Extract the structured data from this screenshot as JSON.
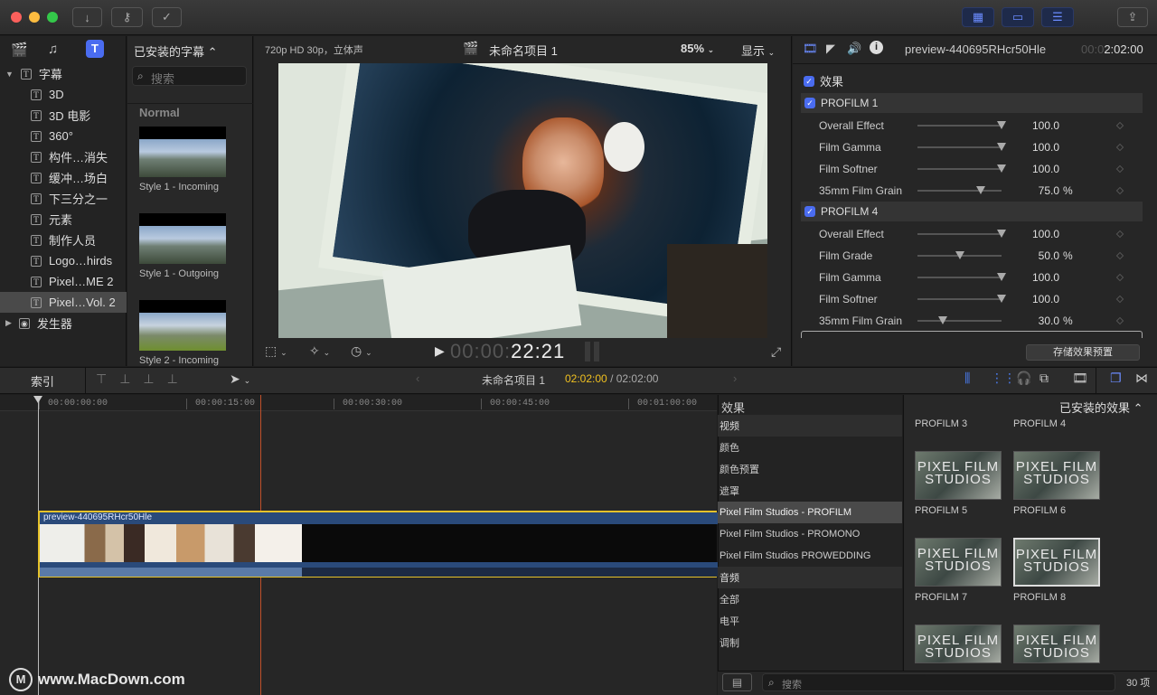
{
  "viewer": {
    "format": "720p HD 30p，立体声",
    "project_title": "未命名项目 1",
    "zoom": "85%",
    "display": "显示",
    "timecode_dim": "00:00:",
    "timecode": "22:21"
  },
  "browser": {
    "header": "已安装的字幕 ⌃",
    "search_placeholder": "搜索",
    "section": "Normal",
    "thumbs": [
      {
        "caption": "Style 1 - Incoming"
      },
      {
        "caption": "Style 1 - Outgoing"
      },
      {
        "caption": "Style 2 - Incoming"
      }
    ]
  },
  "sidebar": {
    "root": "字幕",
    "items": [
      "3D",
      "3D 电影",
      "360°",
      "构件…消失",
      "缓冲…场白",
      "下三分之一",
      "元素",
      "制作人员",
      "Logo…hirds",
      "Pixel…ME 2",
      "Pixel…Vol. 2"
    ],
    "generators": "发生器"
  },
  "inspector": {
    "clip_name": "preview-440695RHcr50Hle",
    "duration_dim": "00:0",
    "duration": "2:02:00",
    "effects_label": "效果",
    "groups": [
      {
        "name": "PROFILM 1",
        "params": [
          {
            "label": "Overall Effect",
            "value": "100.0",
            "unit": "",
            "level": 1.0
          },
          {
            "label": "Film Gamma",
            "value": "100.0",
            "unit": "",
            "level": 1.0
          },
          {
            "label": "Film Softner",
            "value": "100.0",
            "unit": "",
            "level": 1.0
          },
          {
            "label": "35mm Film Grain",
            "value": "75.0",
            "unit": "%",
            "level": 0.75
          }
        ]
      },
      {
        "name": "PROFILM 4",
        "params": [
          {
            "label": "Overall Effect",
            "value": "100.0",
            "unit": "",
            "level": 1.0
          },
          {
            "label": "Film Grade",
            "value": "50.0",
            "unit": "%",
            "level": 0.5
          },
          {
            "label": "Film Gamma",
            "value": "100.0",
            "unit": "",
            "level": 1.0
          },
          {
            "label": "Film Softner",
            "value": "100.0",
            "unit": "",
            "level": 1.0
          },
          {
            "label": "35mm Film Grain",
            "value": "30.0",
            "unit": "%",
            "level": 0.3
          }
        ]
      }
    ],
    "save_preset": "存储效果预置"
  },
  "timeline": {
    "index_label": "索引",
    "project": "未命名项目 1",
    "playhead": "02:02:00",
    "total": "/ 02:02:00",
    "ruler": [
      "00:00:00:00",
      "00:00:15:00",
      "00:00:30:00",
      "00:00:45:00",
      "00:01:00:00"
    ],
    "clip_name": "preview-440695RHcr50Hle"
  },
  "effects_browser": {
    "title": "效果",
    "installed": "已安装的效果 ⌃",
    "categories": [
      {
        "label": "视频",
        "type": "header"
      },
      {
        "label": "颜色",
        "type": "item"
      },
      {
        "label": "颜色预置",
        "type": "item"
      },
      {
        "label": "遮罩",
        "type": "item"
      },
      {
        "label": "Pixel Film Studios - PROFILM",
        "type": "selected"
      },
      {
        "label": "Pixel Film Studios - PROMONO",
        "type": "item"
      },
      {
        "label": "Pixel Film Studios PROWEDDING",
        "type": "item"
      },
      {
        "label": "音频",
        "type": "header"
      },
      {
        "label": "全部",
        "type": "item"
      },
      {
        "label": "电平",
        "type": "item"
      },
      {
        "label": "调制",
        "type": "item"
      }
    ],
    "effects": [
      "PROFILM 3",
      "PROFILM 4",
      "PROFILM 5",
      "PROFILM 6",
      "PROFILM 7",
      "PROFILM 8"
    ],
    "thumb_text": "PIXEL FILM STUDIOS",
    "search_placeholder": "搜索",
    "count": "30 项"
  },
  "watermark": "www.MacDown.com",
  "colors": {
    "accent": "#4a6cf0",
    "timecode_orange": "#f0c020",
    "clip_border": "#e6c229",
    "playhead": "#c0502a"
  }
}
